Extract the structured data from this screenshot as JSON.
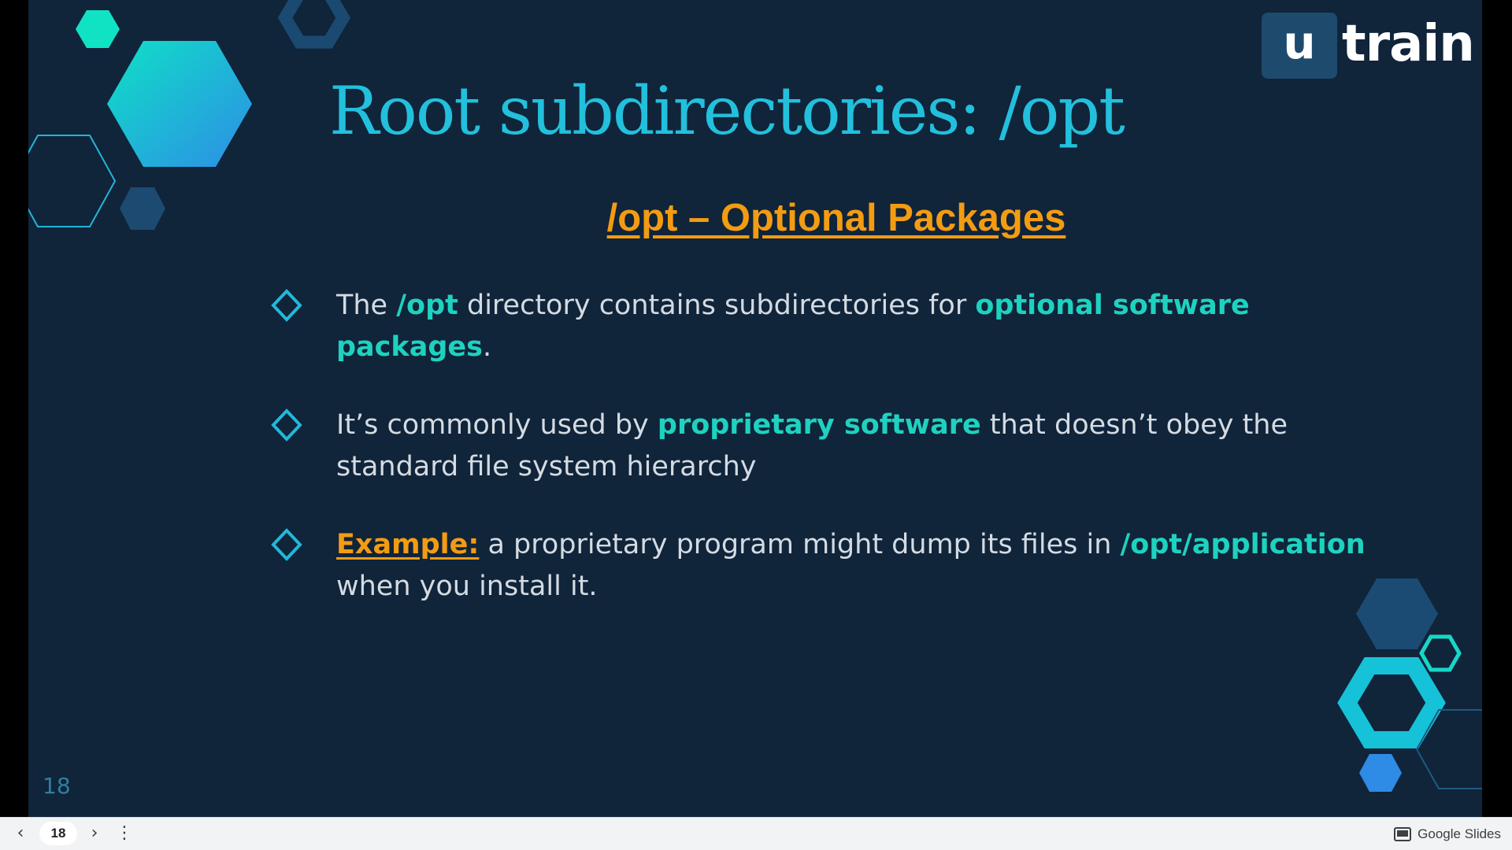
{
  "slide": {
    "logo": {
      "box_letter": "u",
      "word": "train"
    },
    "title": "Root subdirectories: /opt",
    "subtitle": "/opt – Optional Packages",
    "bullets": [
      {
        "parts": [
          {
            "text": "The ",
            "style": "normal"
          },
          {
            "text": "/opt",
            "style": "highlight"
          },
          {
            "text": " directory contains subdirectories for ",
            "style": "normal"
          },
          {
            "text": "optional software packages",
            "style": "highlight"
          },
          {
            "text": ".",
            "style": "normal"
          }
        ]
      },
      {
        "parts": [
          {
            "text": " It’s commonly used by ",
            "style": "normal"
          },
          {
            "text": "proprietary software",
            "style": "highlight"
          },
          {
            "text": " that doesn’t obey the standard file system hierarchy",
            "style": "normal"
          }
        ]
      },
      {
        "parts": [
          {
            "text": "Example:",
            "style": "example"
          },
          {
            "text": " a proprietary program might dump its files in ",
            "style": "normal"
          },
          {
            "text": "/opt/application",
            "style": "highlight"
          },
          {
            "text": " when you install it.",
            "style": "normal"
          }
        ]
      }
    ],
    "slide_number": "18"
  },
  "toolbar": {
    "prev_icon": "chevron-left-icon",
    "prev_glyph": "‹",
    "current_page": "18",
    "next_icon": "chevron-right-icon",
    "next_glyph": "›",
    "more_icon": "vertical-dots-icon",
    "more_glyph": "⋮",
    "brand_label": "Google Slides",
    "brand_icon": "slides-icon"
  },
  "colors": {
    "background": "#10243a",
    "title": "#22c0dc",
    "subtitle": "#f39c12",
    "highlight": "#1ed2bf",
    "body_text": "#d4dbe2",
    "example": "#f39c12",
    "toolbar_bg": "#f1f3f4"
  }
}
